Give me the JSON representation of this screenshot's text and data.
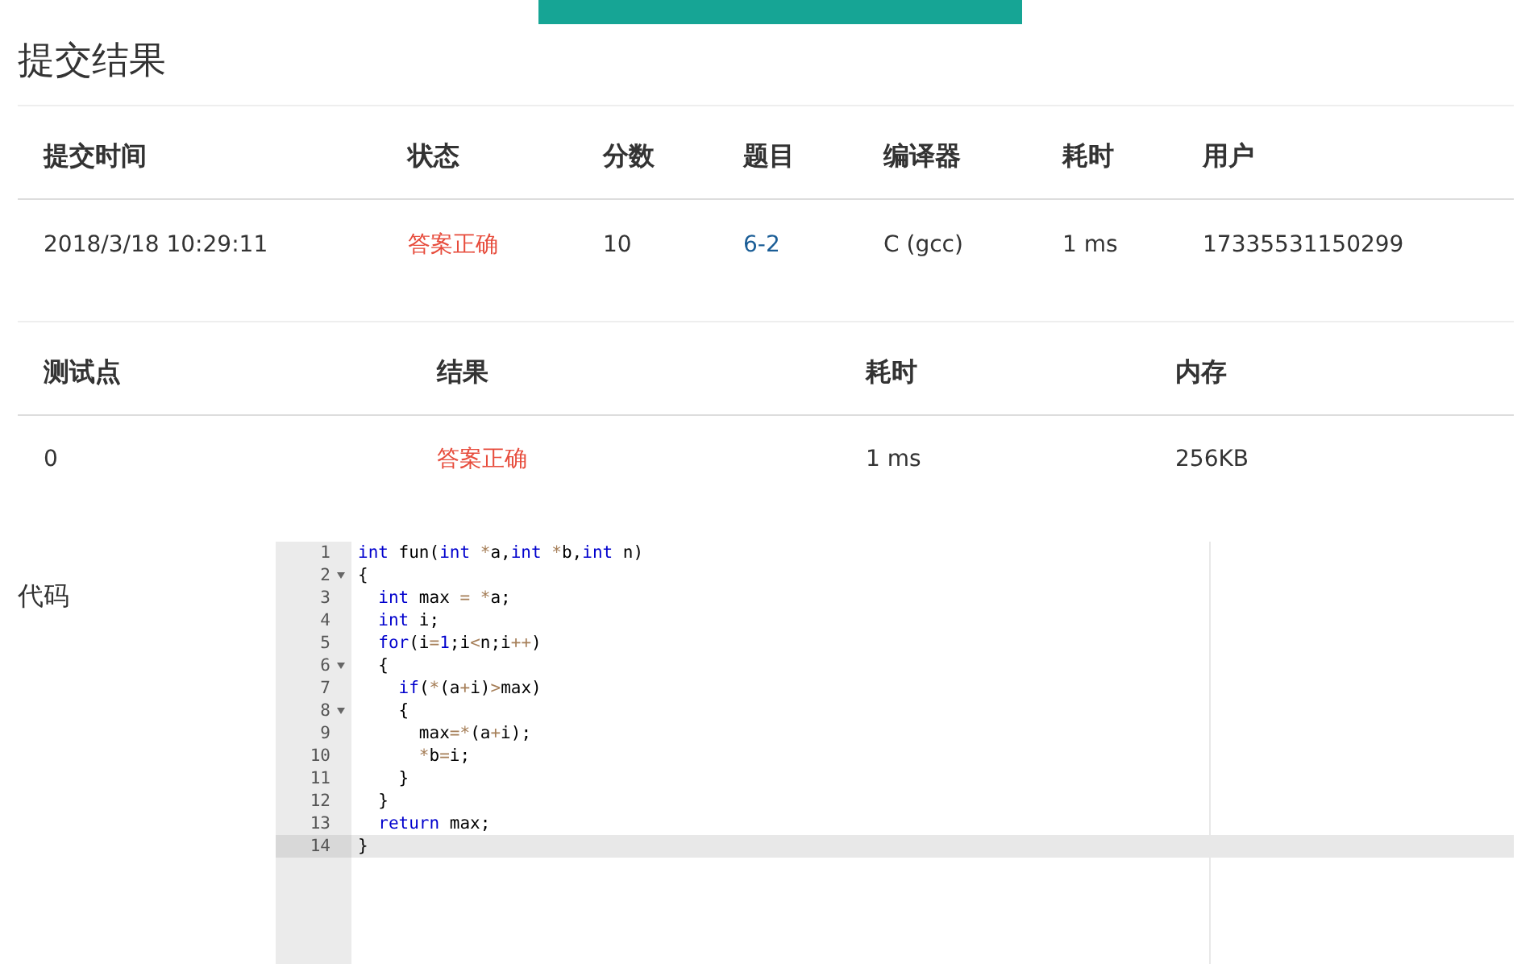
{
  "title": "提交结果",
  "submission": {
    "columns": [
      "提交时间",
      "状态",
      "分数",
      "题目",
      "编译器",
      "耗时",
      "用户"
    ],
    "row": {
      "time": "2018/3/18 10:29:11",
      "status": "答案正确",
      "score": "10",
      "problem": "6-2",
      "compiler": "C (gcc)",
      "elapsed": "1 ms",
      "user": "17335531150299"
    }
  },
  "testcases": {
    "columns": [
      "测试点",
      "结果",
      "耗时",
      "内存"
    ],
    "rows": [
      {
        "case": "0",
        "result": "答案正确",
        "elapsed": "1 ms",
        "memory": "256KB"
      }
    ]
  },
  "code": {
    "label": "代码",
    "lines": [
      {
        "number": "1",
        "foldable": false,
        "active": false,
        "tokens": [
          {
            "kind": "keyword",
            "text": "int"
          },
          {
            "kind": "plain",
            "text": " fun("
          },
          {
            "kind": "keyword",
            "text": "int"
          },
          {
            "kind": "operator",
            "text": " *"
          },
          {
            "kind": "plain",
            "text": "a,"
          },
          {
            "kind": "keyword",
            "text": "int"
          },
          {
            "kind": "operator",
            "text": " *"
          },
          {
            "kind": "plain",
            "text": "b,"
          },
          {
            "kind": "keyword",
            "text": "int"
          },
          {
            "kind": "plain",
            "text": " n)"
          }
        ]
      },
      {
        "number": "2",
        "foldable": true,
        "active": false,
        "tokens": [
          {
            "kind": "plain",
            "text": "{"
          }
        ]
      },
      {
        "number": "3",
        "foldable": false,
        "active": false,
        "tokens": [
          {
            "kind": "keyword",
            "text": "  int"
          },
          {
            "kind": "plain",
            "text": " max "
          },
          {
            "kind": "operator",
            "text": "= *"
          },
          {
            "kind": "plain",
            "text": "a;"
          }
        ]
      },
      {
        "number": "4",
        "foldable": false,
        "active": false,
        "tokens": [
          {
            "kind": "keyword",
            "text": "  int"
          },
          {
            "kind": "plain",
            "text": " i;"
          }
        ]
      },
      {
        "number": "5",
        "foldable": false,
        "active": false,
        "tokens": [
          {
            "kind": "keyword",
            "text": "  for"
          },
          {
            "kind": "plain",
            "text": "(i"
          },
          {
            "kind": "operator",
            "text": "="
          },
          {
            "kind": "number",
            "text": "1"
          },
          {
            "kind": "plain",
            "text": ";i"
          },
          {
            "kind": "operator",
            "text": "<"
          },
          {
            "kind": "plain",
            "text": "n;i"
          },
          {
            "kind": "operator",
            "text": "++"
          },
          {
            "kind": "plain",
            "text": ")"
          }
        ]
      },
      {
        "number": "6",
        "foldable": true,
        "active": false,
        "tokens": [
          {
            "kind": "plain",
            "text": "  {"
          }
        ]
      },
      {
        "number": "7",
        "foldable": false,
        "active": false,
        "tokens": [
          {
            "kind": "keyword",
            "text": "    if"
          },
          {
            "kind": "plain",
            "text": "("
          },
          {
            "kind": "operator",
            "text": "*"
          },
          {
            "kind": "plain",
            "text": "(a"
          },
          {
            "kind": "operator",
            "text": "+"
          },
          {
            "kind": "plain",
            "text": "i)"
          },
          {
            "kind": "operator",
            "text": ">"
          },
          {
            "kind": "plain",
            "text": "max)"
          }
        ]
      },
      {
        "number": "8",
        "foldable": true,
        "active": false,
        "tokens": [
          {
            "kind": "plain",
            "text": "    {"
          }
        ]
      },
      {
        "number": "9",
        "foldable": false,
        "active": false,
        "tokens": [
          {
            "kind": "plain",
            "text": "      max"
          },
          {
            "kind": "operator",
            "text": "=*"
          },
          {
            "kind": "plain",
            "text": "(a"
          },
          {
            "kind": "operator",
            "text": "+"
          },
          {
            "kind": "plain",
            "text": "i);"
          }
        ]
      },
      {
        "number": "10",
        "foldable": false,
        "active": false,
        "tokens": [
          {
            "kind": "operator",
            "text": "      *"
          },
          {
            "kind": "plain",
            "text": "b"
          },
          {
            "kind": "operator",
            "text": "="
          },
          {
            "kind": "plain",
            "text": "i;"
          }
        ]
      },
      {
        "number": "11",
        "foldable": false,
        "active": false,
        "tokens": [
          {
            "kind": "plain",
            "text": "    }"
          }
        ]
      },
      {
        "number": "12",
        "foldable": false,
        "active": false,
        "tokens": [
          {
            "kind": "plain",
            "text": "  }"
          }
        ]
      },
      {
        "number": "13",
        "foldable": false,
        "active": false,
        "tokens": [
          {
            "kind": "keyword",
            "text": "  return"
          },
          {
            "kind": "plain",
            "text": " max;"
          }
        ]
      },
      {
        "number": "14",
        "foldable": false,
        "active": true,
        "tokens": [
          {
            "kind": "plain",
            "text": "}"
          }
        ]
      }
    ]
  }
}
